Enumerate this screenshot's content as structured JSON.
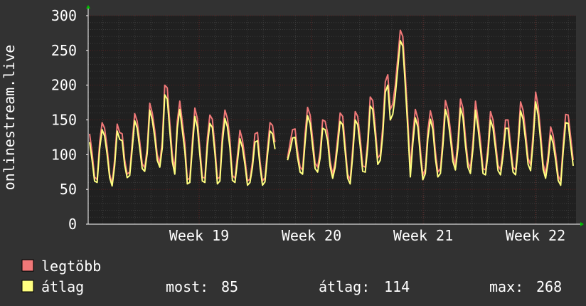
{
  "chart_data": {
    "type": "line",
    "ylabel": "onlinestream.live",
    "ylim": [
      0,
      300
    ],
    "y_ticks": [
      0,
      50,
      100,
      150,
      200,
      250,
      300
    ],
    "x_ticks": [
      "Week 19",
      "Week 20",
      "Week 21",
      "Week 22"
    ],
    "grid": true,
    "legend_placement": "bottom-left",
    "series": [
      {
        "name": "legtöbb",
        "color": "#f07878",
        "values": [
          130,
          103,
          68,
          64,
          118,
          146,
          138,
          110,
          72,
          58,
          93,
          144,
          132,
          130,
          93,
          72,
          75,
          118,
          159,
          148,
          119,
          87,
          81,
          110,
          174,
          160,
          135,
          100,
          88,
          120,
          200,
          196,
          147,
          100,
          80,
          148,
          177,
          147,
          117,
          64,
          66,
          120,
          167,
          152,
          110,
          68,
          66,
          124,
          157,
          151,
          112,
          65,
          68,
          130,
          164,
          152,
          122,
          70,
          66,
          100,
          135,
          121,
          95,
          62,
          65,
          90,
          130,
          132,
          91,
          62,
          67,
          110,
          146,
          142,
          118,
          null,
          null,
          null,
          null,
          95,
          117,
          136,
          137,
          106,
          82,
          78,
          130,
          168,
          157,
          123,
          88,
          82,
          104,
          150,
          148,
          131,
          91,
          72,
          90,
          124,
          160,
          155,
          114,
          72,
          64,
          108,
          162,
          155,
          124,
          84,
          82,
          122,
          183,
          178,
          140,
          95,
          100,
          140,
          205,
          215,
          165,
          173,
          200,
          240,
          279,
          270,
          215,
          150,
          80,
          128,
          165,
          152,
          108,
          70,
          80,
          135,
          163,
          148,
          105,
          75,
          80,
          124,
          178,
          165,
          135,
          100,
          85,
          120,
          180,
          167,
          125,
          90,
          80,
          120,
          177,
          152,
          120,
          80,
          78,
          112,
          162,
          150,
          119,
          85,
          78,
          108,
          150,
          150,
          115,
          82,
          78,
          120,
          176,
          164,
          132,
          95,
          85,
          130,
          190,
          170,
          132,
          87,
          73,
          100,
          140,
          128,
          102,
          70,
          62,
          115,
          158,
          157,
          125,
          92
        ]
      },
      {
        "name": "átlag",
        "color": "#ffff80",
        "values": [
          118,
          92,
          62,
          60,
          108,
          136,
          127,
          100,
          67,
          55,
          84,
          134,
          122,
          120,
          85,
          67,
          70,
          108,
          149,
          138,
          109,
          80,
          76,
          102,
          164,
          150,
          125,
          92,
          82,
          110,
          186,
          180,
          135,
          90,
          72,
          138,
          165,
          135,
          105,
          58,
          60,
          110,
          155,
          140,
          100,
          62,
          60,
          112,
          145,
          139,
          102,
          58,
          62,
          118,
          152,
          140,
          110,
          63,
          60,
          90,
          123,
          110,
          86,
          56,
          60,
          82,
          118,
          120,
          83,
          56,
          61,
          100,
          134,
          130,
          108,
          null,
          null,
          null,
          null,
          92,
          106,
          124,
          125,
          96,
          75,
          72,
          118,
          156,
          145,
          112,
          80,
          75,
          95,
          138,
          136,
          120,
          83,
          66,
          82,
          113,
          148,
          143,
          104,
          66,
          58,
          98,
          150,
          143,
          112,
          76,
          75,
          111,
          170,
          165,
          128,
          86,
          92,
          128,
          190,
          200,
          150,
          158,
          185,
          225,
          264,
          256,
          200,
          136,
          68,
          116,
          153,
          140,
          98,
          64,
          73,
          123,
          151,
          136,
          95,
          68,
          73,
          113,
          165,
          152,
          123,
          90,
          78,
          109,
          167,
          154,
          113,
          82,
          73,
          109,
          164,
          139,
          108,
          73,
          71,
          102,
          150,
          138,
          108,
          77,
          71,
          98,
          138,
          138,
          104,
          75,
          71,
          109,
          163,
          151,
          120,
          86,
          77,
          118,
          176,
          157,
          120,
          79,
          66,
          90,
          128,
          116,
          92,
          63,
          56,
          104,
          146,
          145,
          113,
          84
        ]
      }
    ],
    "stats": {
      "most_label": "most:",
      "most_value": "85",
      "atlag_label": "átlag:",
      "atlag_value": "114",
      "max_label": "max:",
      "max_value": "268"
    }
  },
  "colors": {
    "background": "#323232",
    "plot_background": "#202020",
    "grid_major": "#5a2020",
    "grid_minor": "#3a3a3a",
    "axis": "#ffffff",
    "arrow": "#00c000"
  }
}
